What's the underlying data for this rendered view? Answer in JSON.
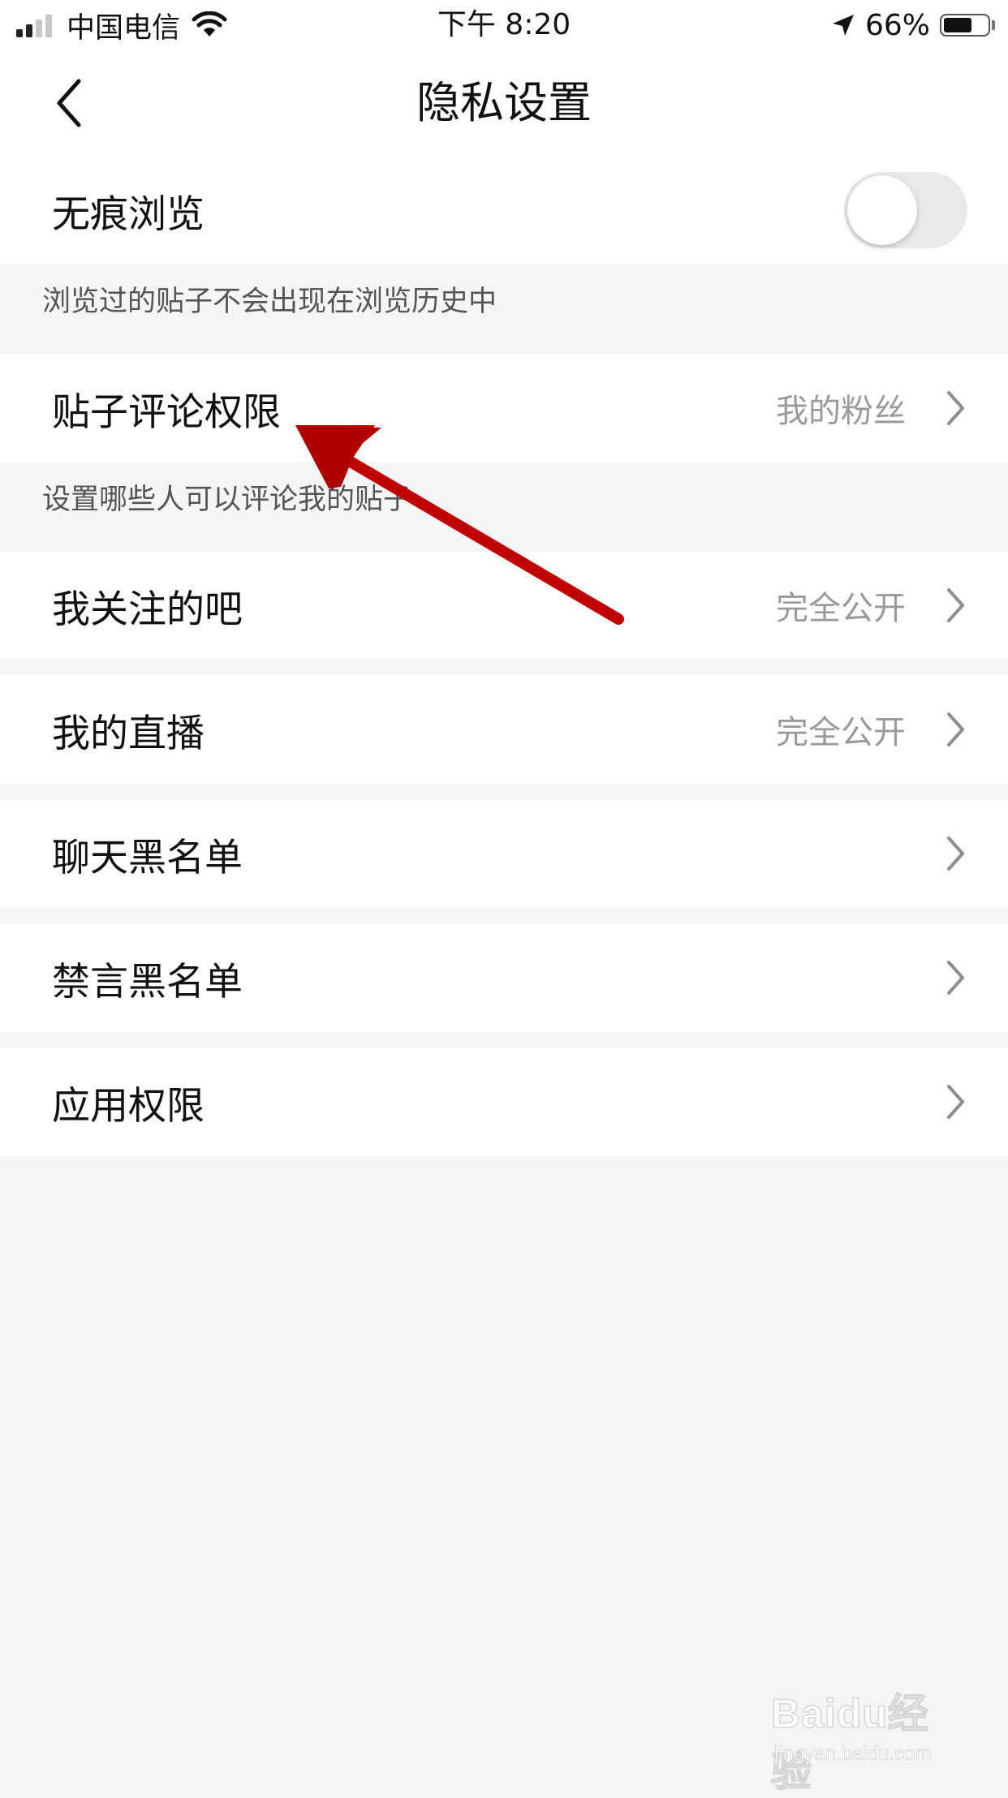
{
  "status_bar": {
    "carrier": "中国电信",
    "time": "下午 8:20",
    "battery_percent": "66%",
    "battery_level": 0.66,
    "signal_bars_active": 2,
    "signal_bars_total": 4,
    "icons": [
      "signal-icon",
      "wifi-icon",
      "location-arrow-icon",
      "battery-icon"
    ]
  },
  "nav": {
    "title": "隐私设置",
    "back_icon": "chevron-left-icon"
  },
  "settings": {
    "incognito": {
      "label": "无痕浏览",
      "enabled": false,
      "note": "浏览过的贴子不会出现在浏览历史中"
    },
    "post_comment_permission": {
      "label": "贴子评论权限",
      "value": "我的粉丝",
      "note": "设置哪些人可以评论我的贴子"
    },
    "followed_bars": {
      "label": "我关注的吧",
      "value": "完全公开"
    },
    "my_live": {
      "label": "我的直播",
      "value": "完全公开"
    },
    "chat_blacklist": {
      "label": "聊天黑名单"
    },
    "mute_blacklist": {
      "label": "禁言黑名单"
    },
    "app_permissions": {
      "label": "应用权限"
    }
  },
  "watermark": {
    "brand": "Baidu经验",
    "url": "jingyan.baidu.com"
  },
  "colors": {
    "background": "#f5f5f7",
    "cell": "#ffffff",
    "secondary_text": "#9a9a9a",
    "annotation_arrow": "#c00000"
  }
}
